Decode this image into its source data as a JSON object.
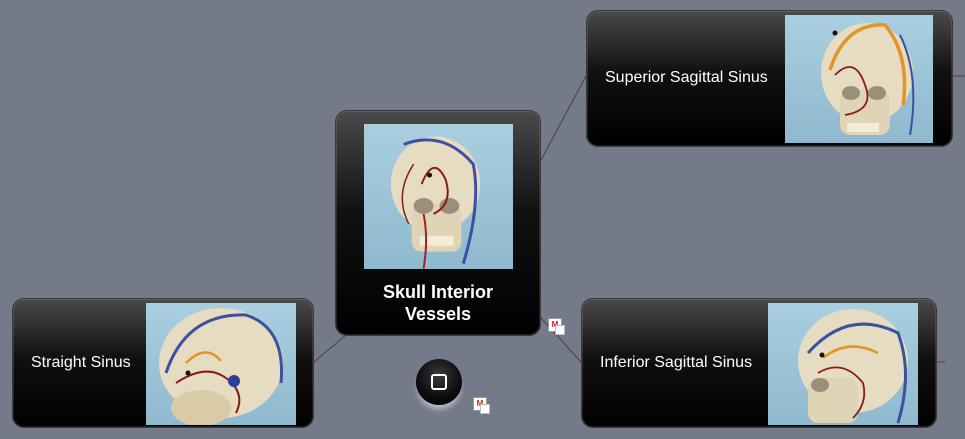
{
  "central_topic": {
    "label_line1": "Skull Interior",
    "label_line2": "Vessels",
    "image_icon": "skull-vessels-image"
  },
  "topics": [
    {
      "label": "Superior Sagittal Sinus",
      "image_icon": "superior-sagittal-sinus-image"
    },
    {
      "label": "Straight Sinus",
      "image_icon": "straight-sinus-image"
    },
    {
      "label": "Inferior Sagittal Sinus",
      "image_icon": "inferior-sagittal-sinus-image"
    }
  ],
  "home_button_icon": "rounded-square-icon",
  "badge_text": "M",
  "colors": {
    "canvas": "#757a8a",
    "node": "#000000",
    "connector": "#3f4350"
  }
}
